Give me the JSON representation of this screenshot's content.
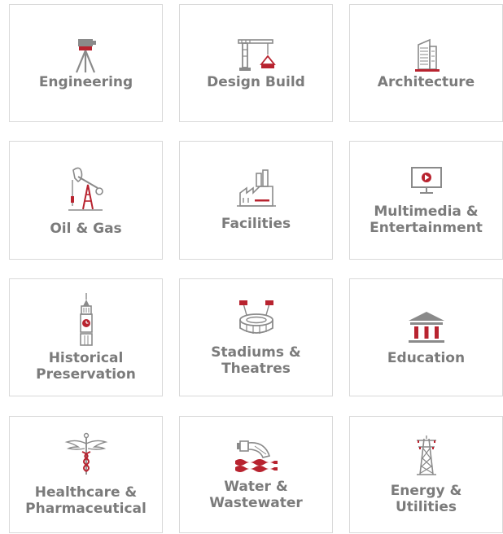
{
  "colors": {
    "accent": "#b8232f",
    "icon_gray": "#8a8a8a",
    "label_gray": "#7b7b7b",
    "border": "#d9d9d9"
  },
  "tiles": [
    {
      "icon": "surveyor-tripod-icon",
      "lines": [
        "Engineering"
      ]
    },
    {
      "icon": "crane-icon",
      "lines": [
        "Design Build"
      ]
    },
    {
      "icon": "skyscraper-icon",
      "lines": [
        "Architecture"
      ]
    },
    {
      "icon": "oil-pump-jack-icon",
      "lines": [
        "Oil & Gas"
      ]
    },
    {
      "icon": "factory-icon",
      "lines": [
        "Facilities"
      ]
    },
    {
      "icon": "monitor-play-icon",
      "lines": [
        "Multimedia &",
        "Entertainment"
      ]
    },
    {
      "icon": "clock-tower-icon",
      "lines": [
        "Historical",
        "Preservation"
      ]
    },
    {
      "icon": "stadium-icon",
      "lines": [
        "Stadiums &",
        "Theatres"
      ]
    },
    {
      "icon": "classical-building-icon",
      "lines": [
        "Education"
      ]
    },
    {
      "icon": "caduceus-icon",
      "lines": [
        "Healthcare &",
        "Pharmaceutical"
      ]
    },
    {
      "icon": "water-outfall-icon",
      "lines": [
        "Water &",
        "Wastewater"
      ]
    },
    {
      "icon": "power-pylon-icon",
      "lines": [
        "Energy &",
        "Utilities"
      ]
    }
  ]
}
